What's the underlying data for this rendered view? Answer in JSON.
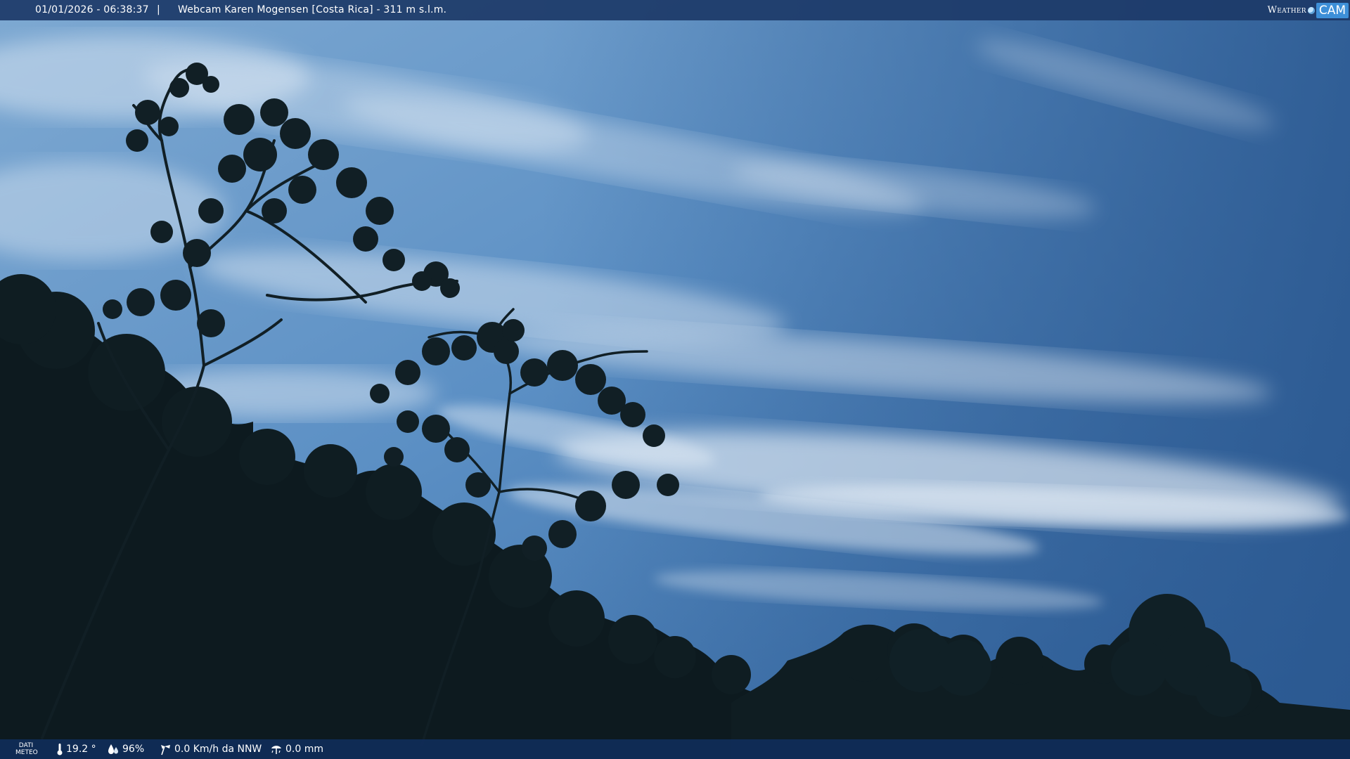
{
  "header": {
    "timestamp": "01/01/2026 - 06:38:37",
    "separator": "|",
    "title": "Webcam Karen Mogensen [Costa Rica]  - 311 m s.l.m.",
    "logo_word": "Weather",
    "logo_cam": "CAM"
  },
  "footer": {
    "dati_line1": "DATI",
    "dati_line2": "METEO",
    "temperature": "19.2 °",
    "humidity": "96%",
    "wind": "0.0 Km/h da NNW",
    "rain": "0.0 mm"
  },
  "colors": {
    "sky_top": "#2f5f98",
    "sky_bottom": "#7aa7d4",
    "vegetation": "#0d1a1f",
    "bar": "#1c3a68",
    "logo_accent": "#3d8fd8"
  }
}
